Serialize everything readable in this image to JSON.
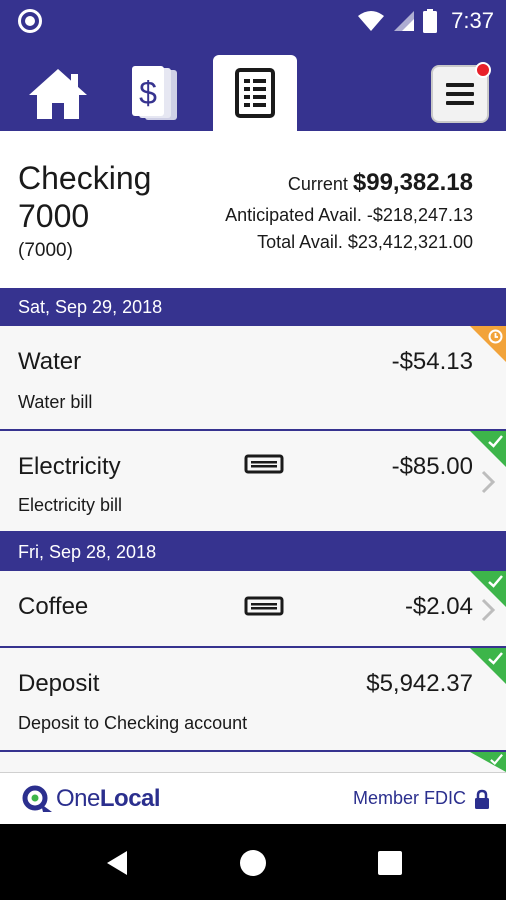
{
  "status_bar": {
    "time": "7:37",
    "icons": [
      "notification-dot-icon",
      "wifi-icon",
      "signal-icon",
      "battery-icon"
    ]
  },
  "nav": {
    "tabs": [
      {
        "icon": "home-icon"
      },
      {
        "icon": "money-icon"
      },
      {
        "icon": "register-icon",
        "selected": true
      },
      {
        "icon": "menu-icon",
        "has_badge": true
      }
    ]
  },
  "account": {
    "name_line1": "Checking",
    "name_line2": "7000",
    "number": "(7000)",
    "current_label": "Current",
    "current_value": "$99,382.18",
    "anticipated": "Anticipated Avail. -$218,247.13",
    "total": "Total Avail. $23,412,321.00"
  },
  "groups": [
    {
      "date": "Sat, Sep 29, 2018",
      "transactions": [
        {
          "title": "Water",
          "description": "Water bill",
          "amount": "-$54.13",
          "status": "pending"
        },
        {
          "title": "Electricity",
          "description": "Electricity bill",
          "amount": "-$85.00",
          "status": "cleared",
          "card_icon": true,
          "chevron": true
        }
      ]
    },
    {
      "date": "Fri, Sep 28, 2018",
      "transactions": [
        {
          "title": "Coffee",
          "description": "",
          "amount": "-$2.04",
          "status": "cleared",
          "card_icon": true,
          "chevron": true
        },
        {
          "title": "Deposit",
          "description": "Deposit to Checking account",
          "amount": "$5,942.37",
          "status": "cleared"
        },
        {
          "title": "",
          "description": "",
          "amount": "",
          "status": "cleared"
        }
      ]
    }
  ],
  "footer": {
    "logo_part1": "One",
    "logo_part2": "Local",
    "fdic": "Member FDIC"
  },
  "colors": {
    "primary": "#36338f",
    "cleared": "#3db54a",
    "pending": "#f2a33a",
    "badge": "#e8202a"
  }
}
